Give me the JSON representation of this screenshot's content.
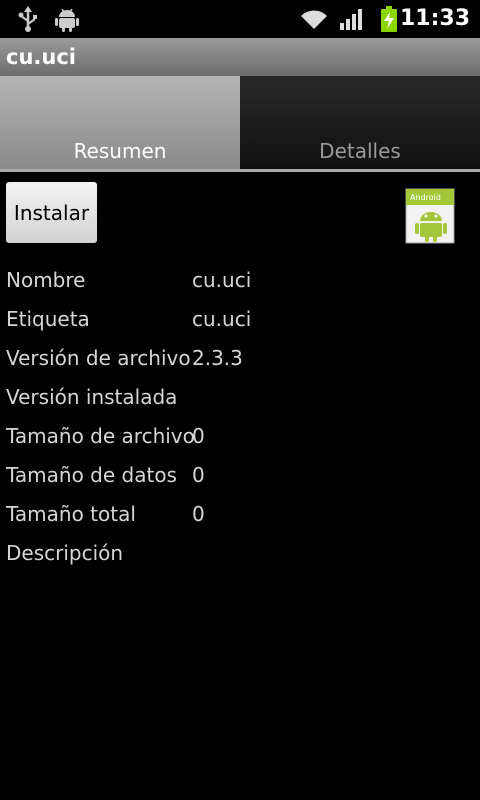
{
  "status_bar": {
    "time": "11:33",
    "icons": [
      "usb-icon",
      "android-debug-icon",
      "wifi-icon",
      "signal-icon",
      "battery-charging-icon"
    ]
  },
  "title_bar": {
    "title": "cu.uci"
  },
  "tabs": [
    {
      "label": "Resumen",
      "active": true
    },
    {
      "label": "Detalles",
      "active": false
    }
  ],
  "actions": {
    "install_label": "Instalar"
  },
  "app_icon": {
    "name": "android-package-icon",
    "badge_text": "Android"
  },
  "details": [
    {
      "label": "Nombre",
      "value": "cu.uci"
    },
    {
      "label": "Etiqueta",
      "value": "cu.uci"
    },
    {
      "label": "Versión de archivo",
      "value": "2.3.3"
    },
    {
      "label": "Versión instalada",
      "value": ""
    },
    {
      "label": "Tamaño de archivo",
      "value": "0"
    },
    {
      "label": "Tamaño de datos",
      "value": "0"
    },
    {
      "label": "Tamaño total",
      "value": "0"
    },
    {
      "label": "Descripción",
      "value": ""
    }
  ],
  "colors": {
    "accent_green": "#a4c639",
    "battery_green": "#8ad600",
    "title_bar_gray": "#7a7a7a"
  }
}
